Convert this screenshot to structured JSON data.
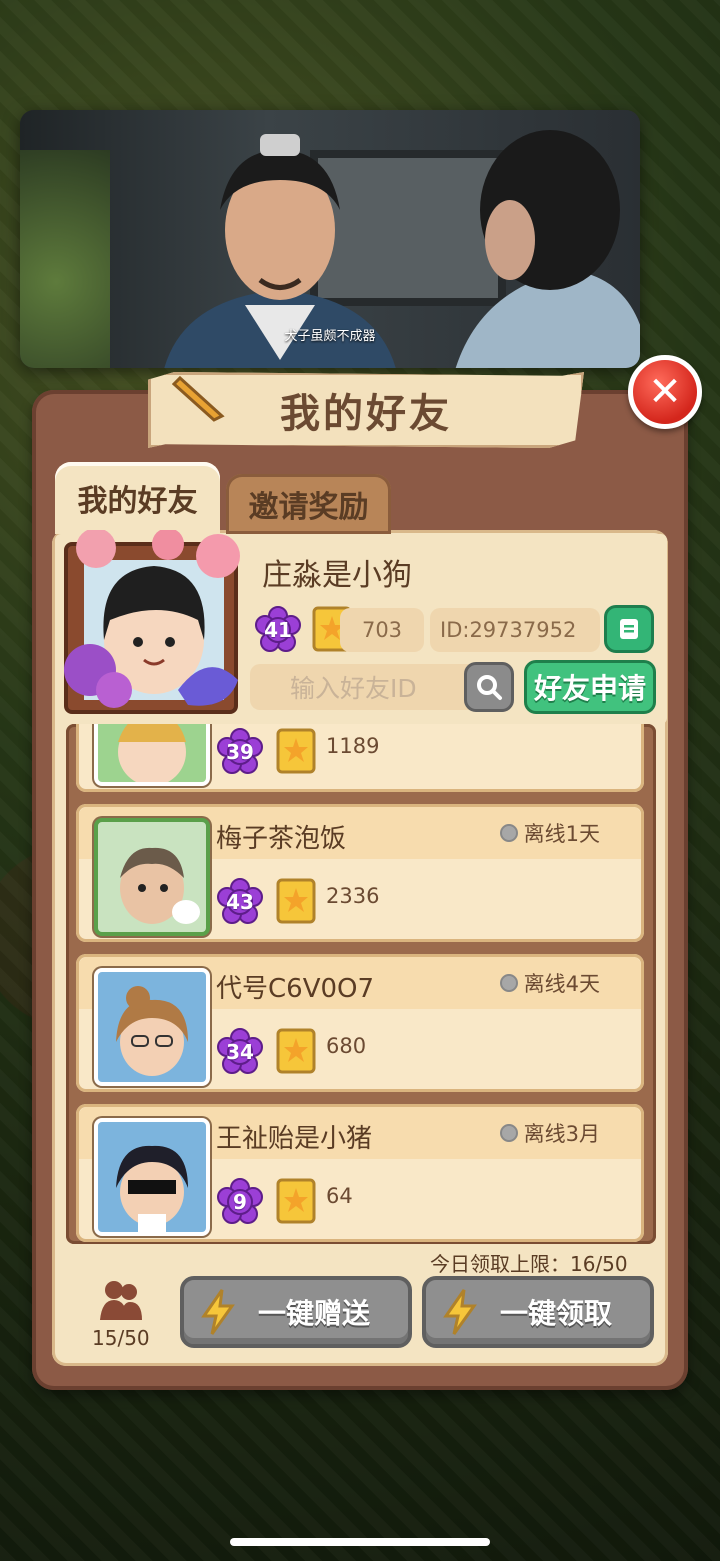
{
  "video": {
    "subtitle": "犬子虽颇不成器"
  },
  "dialog": {
    "title": "我的好友",
    "close_icon": "close-icon",
    "tabs": [
      {
        "label": "我的好友"
      },
      {
        "label": "邀请奖励"
      }
    ]
  },
  "me": {
    "name": "庄淼是小狗",
    "level": "41",
    "stars": "703",
    "id": "ID:29737952"
  },
  "search": {
    "placeholder": "输入好友ID",
    "apply_label": "好友申请"
  },
  "friends": [
    {
      "name": "",
      "level": "39",
      "stars": "1189",
      "status": ""
    },
    {
      "name": "梅子茶泡饭",
      "level": "43",
      "stars": "2336",
      "status": "离线1天"
    },
    {
      "name": "代号C6V0O7",
      "level": "34",
      "stars": "680",
      "status": "离线4天"
    },
    {
      "name": "王祉贻是小猪",
      "level": "9",
      "stars": "64",
      "status": "离线3月"
    }
  ],
  "footer": {
    "daily_limit": "今日领取上限：16/50",
    "friend_count": "15/50",
    "send_all_label": "一键赠送",
    "claim_all_label": "一键领取"
  },
  "colors": {
    "accent_green": "#41c27e",
    "badge_purple": "#9b3fd6",
    "close_red": "#e0332a",
    "panel_brown": "#8c5a46"
  }
}
